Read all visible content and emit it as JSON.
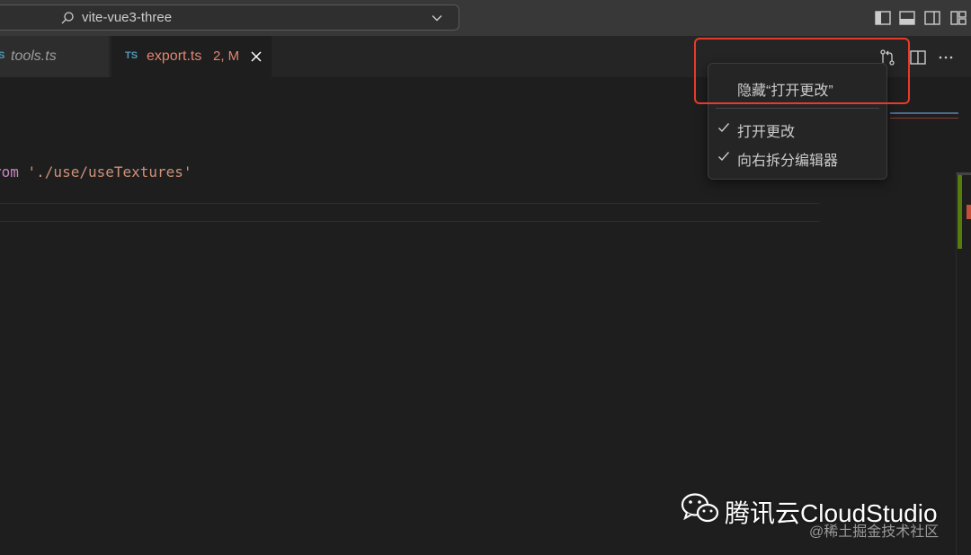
{
  "titlebar": {
    "search_label": "vite-vue3-three",
    "layout_icons": [
      "toggle-primary-sidebar-icon",
      "toggle-panel-icon",
      "toggle-secondary-sidebar-icon",
      "customize-layout-icon"
    ]
  },
  "tabs": [
    {
      "prefix": "S",
      "label": "tools.ts",
      "active": false
    },
    {
      "badge": "TS",
      "label": "export.ts",
      "status": "2, M",
      "active": true
    }
  ],
  "editor": {
    "code_keyword": "rom ",
    "code_string": "'./use/useTextures'"
  },
  "context_menu": {
    "hide_item": "隐藏“打开更改”",
    "items": [
      {
        "label": "打开更改",
        "checked": true
      },
      {
        "label": "向右拆分编辑器",
        "checked": true
      }
    ]
  },
  "watermark": {
    "brand": "腾讯云CloudStudio",
    "credit": "@稀土掘金技术社区"
  },
  "colors": {
    "accent_modified": "#e2856e",
    "ts_badge": "#519aba",
    "highlight": "#e53b2c"
  }
}
